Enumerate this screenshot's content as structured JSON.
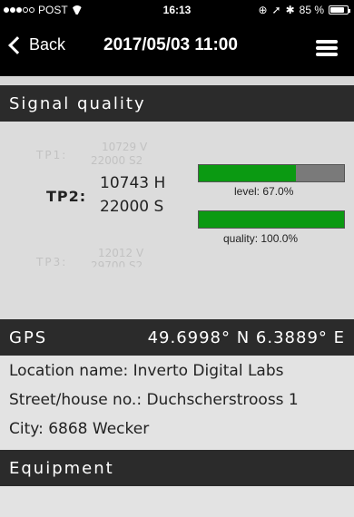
{
  "status_bar": {
    "carrier": "POST",
    "time": "16:13",
    "battery_text": "85 %",
    "battery_level": 0.85
  },
  "nav": {
    "back_label": "Back",
    "title": "2017/05/03 11:00",
    "menu_icon": "hamburger-menu-icon"
  },
  "signal": {
    "header": "Signal quality",
    "tp1": {
      "label": "TP1:",
      "line1": "10729 V",
      "line2": "22000 S2"
    },
    "tp2": {
      "label": "TP2:",
      "line1": "10743 H",
      "line2": "22000 S"
    },
    "tp3": {
      "label": "TP3:",
      "line1": "12012 V",
      "line2": "29700 S2"
    },
    "level": {
      "caption": "level: 67.0%",
      "value": 0.67
    },
    "quality": {
      "caption": "quality: 100.0%",
      "value": 1.0
    },
    "colors": {
      "bar_fill": "#0b9a12",
      "bar_track": "#7a7a7a"
    }
  },
  "gps": {
    "label": "GPS",
    "coordinates": "49.6998° N 6.3889° E"
  },
  "location": {
    "name_line": "Location name:  Inverto Digital Labs",
    "street_line": "Street/house no.:  Duchscherstrooss 1",
    "city_line": "City:  6868 Wecker"
  },
  "equipment": {
    "header": "Equipment"
  }
}
